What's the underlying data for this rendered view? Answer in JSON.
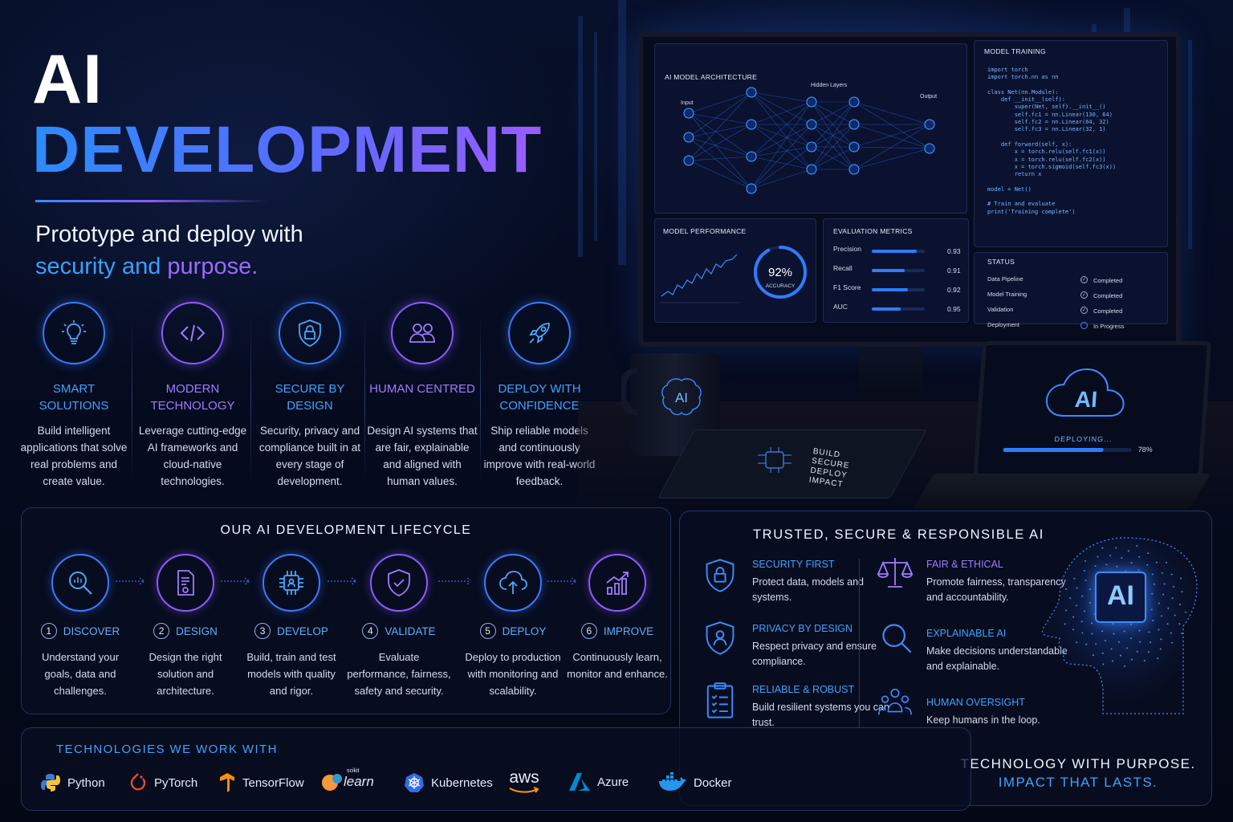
{
  "title": {
    "line1": "AI",
    "line2": "DEVELOPMENT"
  },
  "subtitle": {
    "line1": "Prototype and deploy with",
    "part_a": "security and",
    "part_b": "purpose."
  },
  "features": [
    {
      "title": "SMART SOLUTIONS",
      "desc": "Build intelligent applications that solve real problems and create value.",
      "icon": "lightbulb-icon",
      "color": "#3fa4ff"
    },
    {
      "title": "MODERN TECHNOLOGY",
      "desc": "Leverage cutting-edge AI frameworks and cloud-native technologies.",
      "icon": "code-icon",
      "color": "#a07bff"
    },
    {
      "title": "SECURE BY DESIGN",
      "desc": "Security, privacy and compliance built in at every stage of development.",
      "icon": "shield-lock-icon",
      "color": "#3fa4ff"
    },
    {
      "title": "HUMAN CENTRED",
      "desc": "Design AI systems that are fair, explainable and aligned with human values.",
      "icon": "people-icon",
      "color": "#a07bff"
    },
    {
      "title": "DEPLOY WITH CONFIDENCE",
      "desc": "Ship reliable models and continuously improve with real-world feedback.",
      "icon": "rocket-icon",
      "color": "#3fa4ff"
    }
  ],
  "lifecycle": {
    "title": "OUR AI DEVELOPMENT LIFECYCLE",
    "steps": [
      {
        "num": "1",
        "label": "DISCOVER",
        "desc": "Understand your goals, data and challenges.",
        "icon": "magnifier-chart-icon"
      },
      {
        "num": "2",
        "label": "DESIGN",
        "desc": "Design the right solution and architecture.",
        "icon": "document-design-icon"
      },
      {
        "num": "3",
        "label": "DEVELOP",
        "desc": "Build, train and test models with quality and rigor.",
        "icon": "chip-icon"
      },
      {
        "num": "4",
        "label": "VALIDATE",
        "desc": "Evaluate performance, fairness, safety and security.",
        "icon": "shield-check-icon"
      },
      {
        "num": "5",
        "label": "DEPLOY",
        "desc": "Deploy to production with monitoring and scalability.",
        "icon": "cloud-upload-icon"
      },
      {
        "num": "6",
        "label": "IMPROVE",
        "desc": "Continuously learn, monitor and enhance.",
        "icon": "growth-chart-icon"
      }
    ]
  },
  "trust": {
    "title": "TRUSTED, SECURE & RESPONSIBLE AI",
    "left": [
      {
        "h": "SECURITY FIRST",
        "d": "Protect data, models and systems.",
        "icon": "shield-lock-icon"
      },
      {
        "h": "PRIVACY BY DESIGN",
        "d": "Respect privacy and ensure compliance.",
        "icon": "shield-user-icon"
      },
      {
        "h": "RELIABLE & ROBUST",
        "d": "Build resilient systems you can trust.",
        "icon": "clipboard-check-icon"
      }
    ],
    "right": [
      {
        "h": "FAIR & ETHICAL",
        "d": "Promote fairness, transparency and accountability.",
        "icon": "scales-icon"
      },
      {
        "h": "EXPLAINABLE AI",
        "d": "Make decisions understandable and explainable.",
        "icon": "magnifier-icon"
      },
      {
        "h": "HUMAN OVERSIGHT",
        "d": "Keep humans in the loop.",
        "icon": "people-group-icon"
      }
    ],
    "head_label": "AI"
  },
  "tech": {
    "title": "TECHNOLOGIES WE WORK WITH",
    "items": [
      {
        "name": "Python",
        "icon": "python-icon"
      },
      {
        "name": "PyTorch",
        "icon": "pytorch-icon"
      },
      {
        "name": "TensorFlow",
        "icon": "tensorflow-icon"
      },
      {
        "name": "learn",
        "small": "scikit",
        "icon": "scikit-learn-icon"
      },
      {
        "name": "Kubernetes",
        "icon": "kubernetes-icon"
      },
      {
        "name": "aws",
        "icon": "aws-icon"
      },
      {
        "name": "Azure",
        "icon": "azure-icon"
      },
      {
        "name": "Docker",
        "icon": "docker-icon"
      }
    ]
  },
  "slogan": {
    "line1": "TECHNOLOGY WITH PURPOSE.",
    "line2": "IMPACT THAT LASTS."
  },
  "monitor": {
    "architecture": {
      "title": "AI MODEL ARCHITECTURE",
      "input": "Input",
      "hidden": "Hidden Layers",
      "output": "Output"
    },
    "training": {
      "title": "MODEL TRAINING",
      "code": "import torch\nimport torch.nn as nn\n\nclass Net(nn.Module):\n    def __init__(self):\n        super(Net, self).__init__()\n        self.fc1 = nn.Linear(130, 64)\n        self.fc2 = nn.Linear(64, 32)\n        self.fc3 = nn.Linear(32, 1)\n\n    def forward(self, x):\n        x = torch.relu(self.fc1(x))\n        x = torch.relu(self.fc2(x))\n        x = torch.sigmoid(self.fc3(x))\n        return x\n\nmodel = Net()\n\n# Train and evaluate\nprint('Training complete')"
    },
    "performance": {
      "title": "MODEL PERFORMANCE",
      "accuracy": "92%",
      "accuracy_label": "ACCURACY",
      "accuracy_value": 0.92
    },
    "metrics": {
      "title": "EVALUATION METRICS",
      "rows": [
        {
          "name": "Precision",
          "value": "0.93",
          "fill": 0.85
        },
        {
          "name": "Recall",
          "value": "0.91",
          "fill": 0.62
        },
        {
          "name": "F1 Score",
          "value": "0.92",
          "fill": 0.68
        },
        {
          "name": "AUC",
          "value": "0.95",
          "fill": 0.55
        }
      ]
    },
    "status": {
      "title": "STATUS",
      "rows": [
        {
          "name": "Data Pipeline",
          "state": "Completed"
        },
        {
          "name": "Model Training",
          "state": "Completed"
        },
        {
          "name": "Validation",
          "state": "Completed"
        },
        {
          "name": "Deployment",
          "state": "In Progress"
        }
      ]
    }
  },
  "mug": {
    "label": "AI"
  },
  "notebook": {
    "lines": [
      "BUILD",
      "SECURE",
      "DEPLOY",
      "IMPACT"
    ]
  },
  "laptop": {
    "label": "AI",
    "status": "DEPLOYING...",
    "progress": "78%",
    "progress_value": 0.78
  }
}
